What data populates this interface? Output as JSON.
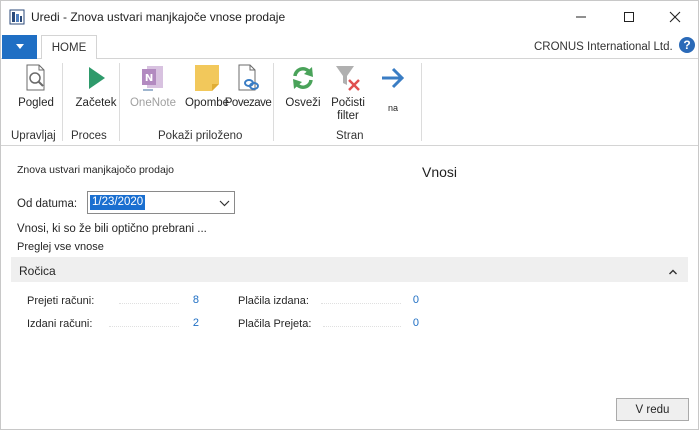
{
  "window": {
    "title": "Uredi - Znova ustvari manjkajoče vnose prodaje"
  },
  "ribbon": {
    "tab_home": "HOME",
    "company": "CRONUS International Ltd.",
    "buttons": {
      "pogled": "Pogled",
      "zacetek": "Začetek",
      "onenote": "OneNote",
      "opombe": "Opombe",
      "povezave": "Povezave",
      "osvezi": "Osveži",
      "pocisti_filter": "Počisti filter",
      "na": "na"
    },
    "groups": {
      "upravljaj": "Upravljaj",
      "proces": "Proces",
      "pokazi_prilozeno": "Pokaži priloženo",
      "stran": "Stran"
    }
  },
  "page": {
    "subtitle": "Znova ustvari manjkajočo prodajo",
    "heading": "Vnosi",
    "date_label": "Od datuma:",
    "date_value": "1/23/2020",
    "link_scanned": "Vnosi, ki so že bili optično prebrani ...",
    "link_all": "Preglej vse vnose",
    "section_title": "Ročica",
    "fields": {
      "prejeti_label": "Prejeti računi:",
      "prejeti_value": "8",
      "izdani_label": "Izdani računi:",
      "izdani_value": "2",
      "placila_izdana_label": "Plačila izdana:",
      "placila_izdana_value": "0",
      "placila_prejeta_label": "Plačila Prejeta:",
      "placila_prejeta_value": "0"
    },
    "ok_button": "V redu"
  }
}
